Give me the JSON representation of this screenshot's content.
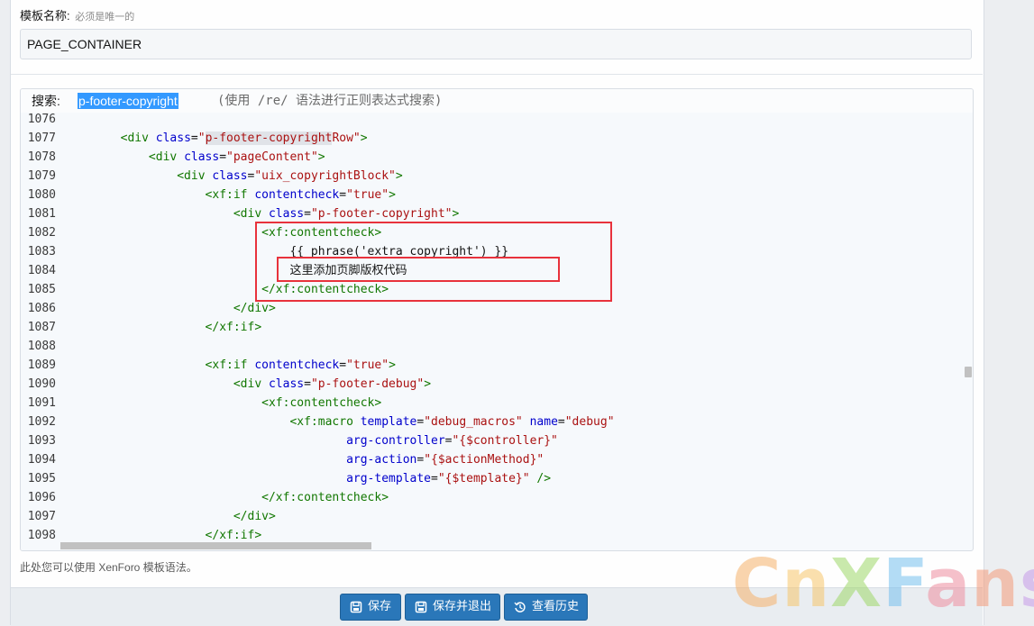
{
  "header": {
    "label": "模板名称:",
    "hint": "必须是唯一的",
    "name_value": "PAGE_CONTAINER"
  },
  "search": {
    "label": "搜索:",
    "query": "p-footer-copyright",
    "hint": "(使用 /re/ 语法进行正则表达式搜索)"
  },
  "code_lines": [
    {
      "n": "1076",
      "tokens": []
    },
    {
      "n": "1077",
      "tokens": [
        [
          "plain",
          "        "
        ],
        [
          "tag",
          "<div "
        ],
        [
          "attr",
          "class"
        ],
        [
          "plain",
          "="
        ],
        [
          "str",
          "\""
        ],
        [
          "hlstr",
          "p-footer-copyright"
        ],
        [
          "str",
          "Row\""
        ],
        [
          "tag",
          ">"
        ]
      ]
    },
    {
      "n": "1078",
      "tokens": [
        [
          "plain",
          "            "
        ],
        [
          "tag",
          "<div "
        ],
        [
          "attr",
          "class"
        ],
        [
          "plain",
          "="
        ],
        [
          "str",
          "\"pageContent\""
        ],
        [
          "tag",
          ">"
        ]
      ]
    },
    {
      "n": "1079",
      "tokens": [
        [
          "plain",
          "                "
        ],
        [
          "tag",
          "<div "
        ],
        [
          "attr",
          "class"
        ],
        [
          "plain",
          "="
        ],
        [
          "str",
          "\"uix_copyrightBlock\""
        ],
        [
          "tag",
          ">"
        ]
      ]
    },
    {
      "n": "1080",
      "tokens": [
        [
          "plain",
          "                    "
        ],
        [
          "tag",
          "<xf:if "
        ],
        [
          "attr",
          "contentcheck"
        ],
        [
          "plain",
          "="
        ],
        [
          "str",
          "\"true\""
        ],
        [
          "tag",
          ">"
        ]
      ]
    },
    {
      "n": "1081",
      "tokens": [
        [
          "plain",
          "                        "
        ],
        [
          "tag",
          "<div "
        ],
        [
          "attr",
          "class"
        ],
        [
          "plain",
          "="
        ],
        [
          "str",
          "\"p-footer-copyright\""
        ],
        [
          "tag",
          ">"
        ]
      ]
    },
    {
      "n": "1082",
      "tokens": [
        [
          "plain",
          "                            "
        ],
        [
          "tag",
          "<xf:contentcheck>"
        ]
      ]
    },
    {
      "n": "1083",
      "tokens": [
        [
          "plain",
          "                                {{ phrase('extra_copyright') }}"
        ]
      ]
    },
    {
      "n": "1084",
      "tokens": [
        [
          "plain",
          "                                "
        ],
        [
          "cjk",
          "这里添加页脚版权代码"
        ]
      ]
    },
    {
      "n": "1085",
      "tokens": [
        [
          "plain",
          "                            "
        ],
        [
          "tag",
          "</xf:contentcheck>"
        ]
      ]
    },
    {
      "n": "1086",
      "tokens": [
        [
          "plain",
          "                        "
        ],
        [
          "tag",
          "</div>"
        ]
      ]
    },
    {
      "n": "1087",
      "tokens": [
        [
          "plain",
          "                    "
        ],
        [
          "tag",
          "</xf:if>"
        ]
      ]
    },
    {
      "n": "1088",
      "tokens": []
    },
    {
      "n": "1089",
      "tokens": [
        [
          "plain",
          "                    "
        ],
        [
          "tag",
          "<xf:if "
        ],
        [
          "attr",
          "contentcheck"
        ],
        [
          "plain",
          "="
        ],
        [
          "str",
          "\"true\""
        ],
        [
          "tag",
          ">"
        ]
      ]
    },
    {
      "n": "1090",
      "tokens": [
        [
          "plain",
          "                        "
        ],
        [
          "tag",
          "<div "
        ],
        [
          "attr",
          "class"
        ],
        [
          "plain",
          "="
        ],
        [
          "str",
          "\"p-footer-debug\""
        ],
        [
          "tag",
          ">"
        ]
      ]
    },
    {
      "n": "1091",
      "tokens": [
        [
          "plain",
          "                            "
        ],
        [
          "tag",
          "<xf:contentcheck>"
        ]
      ]
    },
    {
      "n": "1092",
      "tokens": [
        [
          "plain",
          "                                "
        ],
        [
          "tag",
          "<xf:macro "
        ],
        [
          "attr",
          "template"
        ],
        [
          "plain",
          "="
        ],
        [
          "str",
          "\"debug_macros\""
        ],
        [
          "plain",
          " "
        ],
        [
          "attr",
          "name"
        ],
        [
          "plain",
          "="
        ],
        [
          "str",
          "\"debug\""
        ]
      ]
    },
    {
      "n": "1093",
      "tokens": [
        [
          "plain",
          "                                        "
        ],
        [
          "attr",
          "arg-controller"
        ],
        [
          "plain",
          "="
        ],
        [
          "str",
          "\"{$controller}\""
        ]
      ]
    },
    {
      "n": "1094",
      "tokens": [
        [
          "plain",
          "                                        "
        ],
        [
          "attr",
          "arg-action"
        ],
        [
          "plain",
          "="
        ],
        [
          "str",
          "\"{$actionMethod}\""
        ]
      ]
    },
    {
      "n": "1095",
      "tokens": [
        [
          "plain",
          "                                        "
        ],
        [
          "attr",
          "arg-template"
        ],
        [
          "plain",
          "="
        ],
        [
          "str",
          "\"{$template}\""
        ],
        [
          "plain",
          " "
        ],
        [
          "tag",
          "/>"
        ]
      ]
    },
    {
      "n": "1096",
      "tokens": [
        [
          "plain",
          "                            "
        ],
        [
          "tag",
          "</xf:contentcheck>"
        ]
      ]
    },
    {
      "n": "1097",
      "tokens": [
        [
          "plain",
          "                        "
        ],
        [
          "tag",
          "</div>"
        ]
      ]
    },
    {
      "n": "1098",
      "tokens": [
        [
          "plain",
          "                    "
        ],
        [
          "tag",
          "</xf:if>"
        ]
      ]
    }
  ],
  "note": "此处您可以使用 XenForo 模板语法。",
  "buttons": {
    "save": "保存",
    "save_exit": "保存并退出",
    "history": "查看历史"
  },
  "watermark": {
    "c": "C",
    "n": "n",
    "x": "X",
    "f": "F",
    "a": "a",
    "nn": "n",
    "s": "s"
  },
  "colors": {
    "button": "#2a77b9",
    "highlight_box": "#e8323c",
    "search_selection": "#3399ff",
    "tag": "#117700",
    "attr": "#0000cc",
    "string": "#aa1111"
  }
}
